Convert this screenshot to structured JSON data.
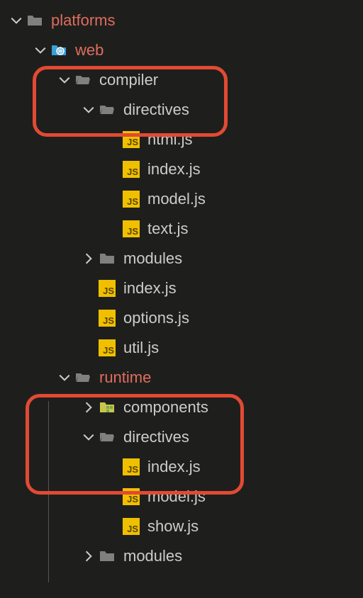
{
  "tree": {
    "platforms": "platforms",
    "web": "web",
    "compiler": "compiler",
    "compiler_directives": "directives",
    "files_html": "html.js",
    "files_index1": "index.js",
    "files_model1": "model.js",
    "files_text": "text.js",
    "modules1": "modules",
    "files_index2": "index.js",
    "files_options": "options.js",
    "files_util": "util.js",
    "runtime": "runtime",
    "components": "components",
    "runtime_directives": "directives",
    "files_index3": "index.js",
    "files_model2": "model.js",
    "files_show": "show.js",
    "modules2": "modules"
  },
  "highlighted": [
    "platforms",
    "web",
    "runtime"
  ],
  "colors": {
    "highlight_text": "#e06c60",
    "annotation_box": "#e24a33",
    "js_icon_bg": "#f0c000",
    "background": "#1e1f1c"
  }
}
